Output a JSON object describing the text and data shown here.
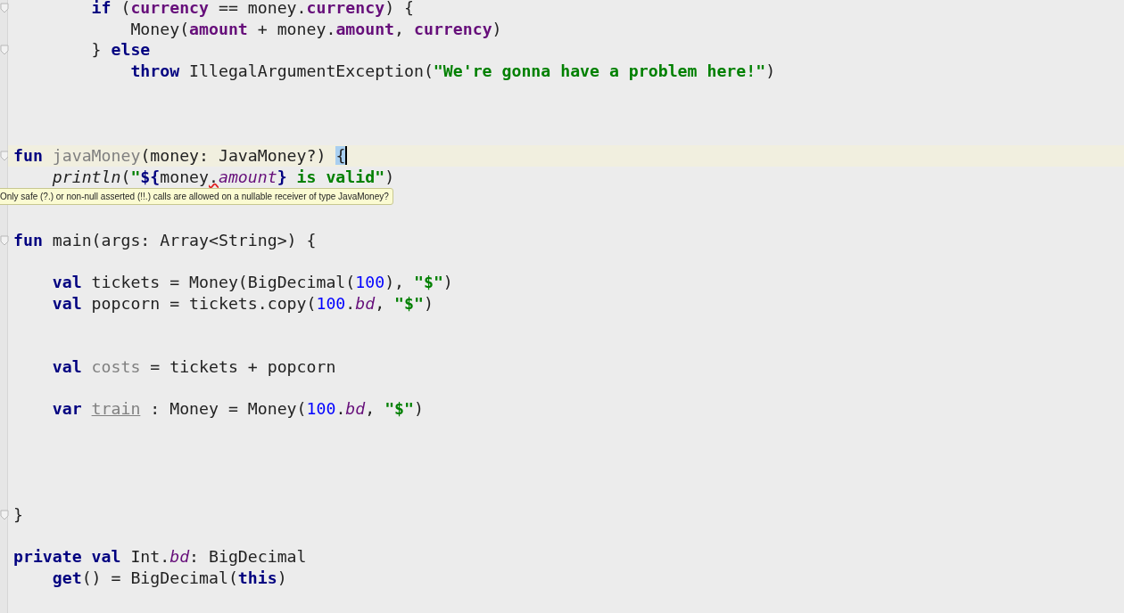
{
  "editor": {
    "lines": [
      {
        "kind": "code",
        "fold": true,
        "current": false,
        "tokens": [
          {
            "t": "        if",
            "kind": "kw"
          },
          {
            "t": " (",
            "kind": "plain"
          },
          {
            "t": "currency",
            "kind": "prop"
          },
          {
            "t": " == money.",
            "kind": "plain"
          },
          {
            "t": "currency",
            "kind": "prop"
          },
          {
            "t": ") {",
            "kind": "plain"
          }
        ]
      },
      {
        "kind": "code",
        "fold": false,
        "current": false,
        "tokens": [
          {
            "t": "            Money(",
            "kind": "plain"
          },
          {
            "t": "amount",
            "kind": "prop"
          },
          {
            "t": " + money.",
            "kind": "plain"
          },
          {
            "t": "amount",
            "kind": "prop"
          },
          {
            "t": ", ",
            "kind": "plain"
          },
          {
            "t": "currency",
            "kind": "prop"
          },
          {
            "t": ")",
            "kind": "plain"
          }
        ]
      },
      {
        "kind": "code",
        "fold": true,
        "current": false,
        "tokens": [
          {
            "t": "        } ",
            "kind": "plain"
          },
          {
            "t": "else",
            "kind": "kw"
          }
        ]
      },
      {
        "kind": "code",
        "fold": false,
        "current": false,
        "tokens": [
          {
            "t": "            throw",
            "kind": "kw"
          },
          {
            "t": " IllegalArgumentException(",
            "kind": "plain"
          },
          {
            "t": "\"We're gonna have a problem here!\"",
            "kind": "str"
          },
          {
            "t": ")",
            "kind": "plain"
          }
        ]
      },
      {
        "kind": "blank"
      },
      {
        "kind": "blank"
      },
      {
        "kind": "blank"
      },
      {
        "kind": "code",
        "fold": true,
        "current": true,
        "tokens": [
          {
            "t": "fun ",
            "kind": "kw"
          },
          {
            "t": "javaMoney",
            "kind": "unused"
          },
          {
            "t": "(money: JavaMoney?) ",
            "kind": "plain"
          },
          {
            "t": "{",
            "kind": "match"
          }
        ]
      },
      {
        "kind": "code",
        "fold": false,
        "current": false,
        "tokens": [
          {
            "t": "    println",
            "kind": "italic"
          },
          {
            "t": "(",
            "kind": "plain"
          },
          {
            "t": "\"",
            "kind": "str"
          },
          {
            "t": "${",
            "kind": "tmpl"
          },
          {
            "t": "money",
            "kind": "plain"
          },
          {
            "t": ".",
            "kind": "error"
          },
          {
            "t": "amount",
            "kind": "ext"
          },
          {
            "t": "}",
            "kind": "tmpl"
          },
          {
            "t": " is valid\"",
            "kind": "str"
          },
          {
            "t": ")",
            "kind": "plain"
          }
        ]
      },
      {
        "kind": "blank",
        "tooltip": "Only safe (?.) or non-null asserted (!!.) calls are allowed on a nullable receiver of type JavaMoney?"
      },
      {
        "kind": "blank"
      },
      {
        "kind": "code",
        "fold": true,
        "current": false,
        "tokens": [
          {
            "t": "fun",
            "kind": "kw"
          },
          {
            "t": " main(args: Array<String>) {",
            "kind": "plain"
          }
        ]
      },
      {
        "kind": "blank"
      },
      {
        "kind": "code",
        "fold": false,
        "current": false,
        "tokens": [
          {
            "t": "    val",
            "kind": "kw"
          },
          {
            "t": " tickets = Money(BigDecimal(",
            "kind": "plain"
          },
          {
            "t": "100",
            "kind": "num"
          },
          {
            "t": "), ",
            "kind": "plain"
          },
          {
            "t": "\"$\"",
            "kind": "str"
          },
          {
            "t": ")",
            "kind": "plain"
          }
        ]
      },
      {
        "kind": "code",
        "fold": false,
        "current": false,
        "tokens": [
          {
            "t": "    val",
            "kind": "kw"
          },
          {
            "t": " popcorn = tickets.copy(",
            "kind": "plain"
          },
          {
            "t": "100",
            "kind": "num"
          },
          {
            "t": ".",
            "kind": "plain"
          },
          {
            "t": "bd",
            "kind": "ext"
          },
          {
            "t": ", ",
            "kind": "plain"
          },
          {
            "t": "\"$\"",
            "kind": "str"
          },
          {
            "t": ")",
            "kind": "plain"
          }
        ]
      },
      {
        "kind": "blank"
      },
      {
        "kind": "blank"
      },
      {
        "kind": "code",
        "fold": false,
        "current": false,
        "tokens": [
          {
            "t": "    val ",
            "kind": "kw"
          },
          {
            "t": "costs",
            "kind": "unused"
          },
          {
            "t": " = tickets + popcorn",
            "kind": "plain"
          }
        ]
      },
      {
        "kind": "blank"
      },
      {
        "kind": "code",
        "fold": false,
        "current": false,
        "tokens": [
          {
            "t": "    var ",
            "kind": "kw"
          },
          {
            "t": "train",
            "kind": "var"
          },
          {
            "t": " : Money = Money(",
            "kind": "plain"
          },
          {
            "t": "100",
            "kind": "num"
          },
          {
            "t": ".",
            "kind": "plain"
          },
          {
            "t": "bd",
            "kind": "ext"
          },
          {
            "t": ", ",
            "kind": "plain"
          },
          {
            "t": "\"$\"",
            "kind": "str"
          },
          {
            "t": ")",
            "kind": "plain"
          }
        ]
      },
      {
        "kind": "blank"
      },
      {
        "kind": "blank"
      },
      {
        "kind": "blank"
      },
      {
        "kind": "blank"
      },
      {
        "kind": "code",
        "fold": true,
        "current": false,
        "tokens": [
          {
            "t": "}",
            "kind": "plain"
          }
        ]
      },
      {
        "kind": "blank"
      },
      {
        "kind": "code",
        "fold": false,
        "current": false,
        "tokens": [
          {
            "t": "private val",
            "kind": "kw"
          },
          {
            "t": " Int.",
            "kind": "plain"
          },
          {
            "t": "bd",
            "kind": "ext"
          },
          {
            "t": ": BigDecimal",
            "kind": "plain"
          }
        ]
      },
      {
        "kind": "code",
        "fold": false,
        "current": false,
        "tokens": [
          {
            "t": "    get",
            "kind": "kw"
          },
          {
            "t": "() = BigDecimal(",
            "kind": "plain"
          },
          {
            "t": "this",
            "kind": "kw"
          },
          {
            "t": ")",
            "kind": "plain"
          }
        ]
      }
    ]
  }
}
